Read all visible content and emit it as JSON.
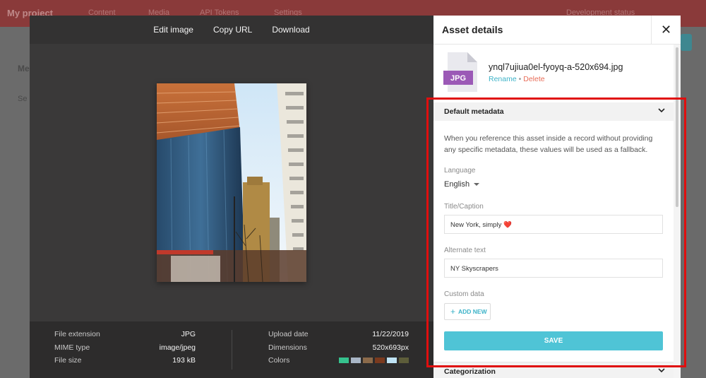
{
  "background": {
    "project_name": "My project",
    "nav_items": [
      "Content",
      "Media",
      "API Tokens",
      "Settings"
    ],
    "environment": "Development status",
    "sidebar_title": "Me",
    "sidebar_search": "Se"
  },
  "toolbar": {
    "edit_image": "Edit image",
    "copy_url": "Copy URL",
    "download": "Download"
  },
  "file_meta": {
    "left": [
      {
        "label": "File extension",
        "value": "JPG"
      },
      {
        "label": "MIME type",
        "value": "image/jpeg"
      },
      {
        "label": "File size",
        "value": "193 kB"
      }
    ],
    "right": [
      {
        "label": "Upload date",
        "value": "11/22/2019"
      },
      {
        "label": "Dimensions",
        "value": "520x693px"
      },
      {
        "label": "Colors",
        "value": ""
      }
    ],
    "colors": [
      "#36c28e",
      "#a9b6c6",
      "#8b6a4a",
      "#7a3a1e",
      "#bfe3f5",
      "#5d5d3a"
    ]
  },
  "panel": {
    "title": "Asset details",
    "file_type": "JPG",
    "file_name": "ynql7ujiua0el-fyoyq-a-520x694.jpg",
    "rename": "Rename",
    "separator": "•",
    "delete": "Delete",
    "default_metadata": {
      "heading": "Default metadata",
      "help": "When you reference this asset inside a record without providing any specific metadata, these values will be used as a fallback.",
      "language_label": "Language",
      "language_value": "English",
      "title_label": "Title/Caption",
      "title_value": "New York, simply ❤️",
      "alt_label": "Alternate text",
      "alt_value": "NY Skyscrapers",
      "custom_label": "Custom data",
      "add_new": "ADD NEW",
      "save": "SAVE"
    },
    "categorization": "Categorization"
  },
  "accent_colors": {
    "link": "#3db3c8",
    "delete": "#e86c57",
    "save": "#4fc4d6",
    "highlight": "#e00e0e",
    "file_badge": "#9b59b6"
  }
}
